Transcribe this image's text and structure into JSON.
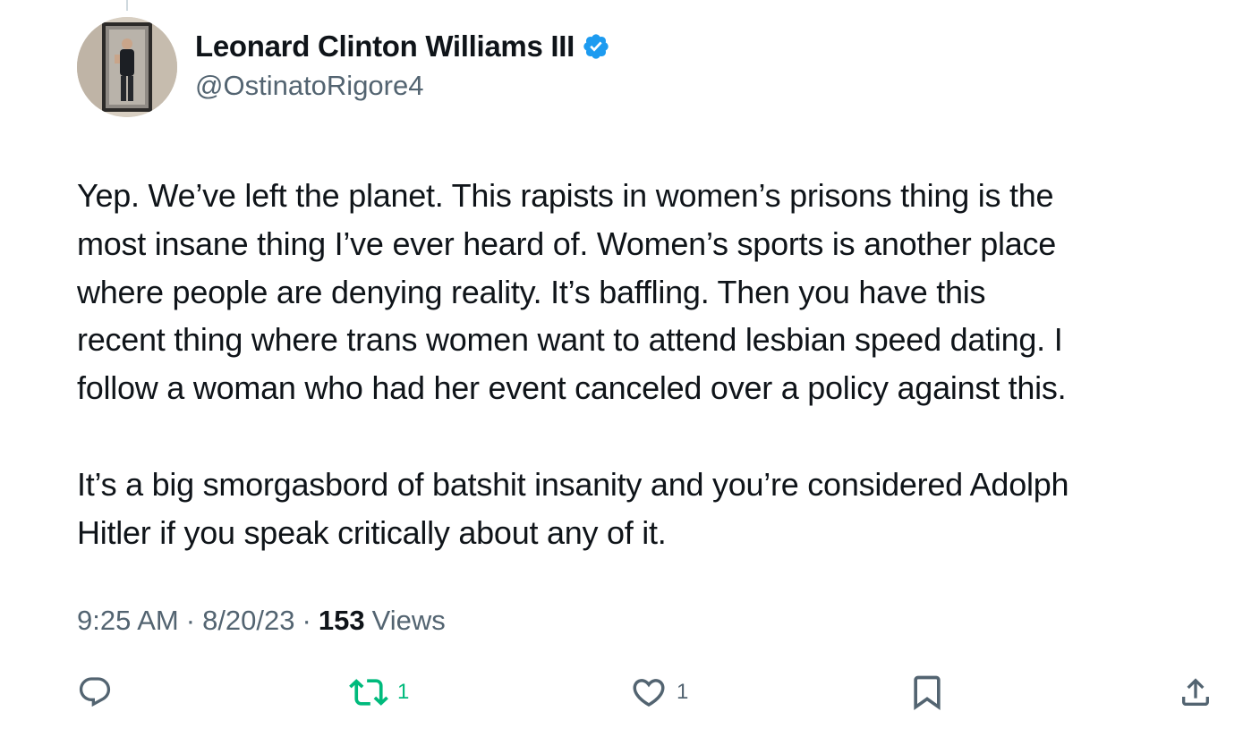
{
  "author": {
    "display_name": "Leonard Clinton Williams III",
    "handle": "@OstinatoRigore4",
    "verified": true
  },
  "tweet": {
    "paragraphs": [
      "Yep. We’ve left the planet. This rapists in women’s prisons thing is the\nmost insane thing I’ve ever heard of. Women’s sports is another place\nwhere people are denying reality. It’s baffling. Then you have this\nrecent thing where trans women want to attend lesbian speed dating. I\nfollow a woman who had her event canceled over a policy against this.",
      "It’s a big smorgasbord of batshit insanity and you’re considered Adolph\nHitler if you speak critically about any of it."
    ],
    "time": "9:25 AM",
    "date": "8/20/23",
    "separator": "·",
    "views_count": "153",
    "views_label": "Views"
  },
  "actions": {
    "reply_icon": "speech-bubble",
    "retweet_icon": "retweet-arrows",
    "retweet_count": "1",
    "like_icon": "heart-outline",
    "like_count": "1",
    "bookmark_icon": "bookmark-outline",
    "share_icon": "share-upload"
  },
  "colors": {
    "text_primary": "#0f1419",
    "text_secondary": "#536471",
    "verified_blue": "#1d9bf0",
    "retweet_green": "#00ba7c"
  }
}
